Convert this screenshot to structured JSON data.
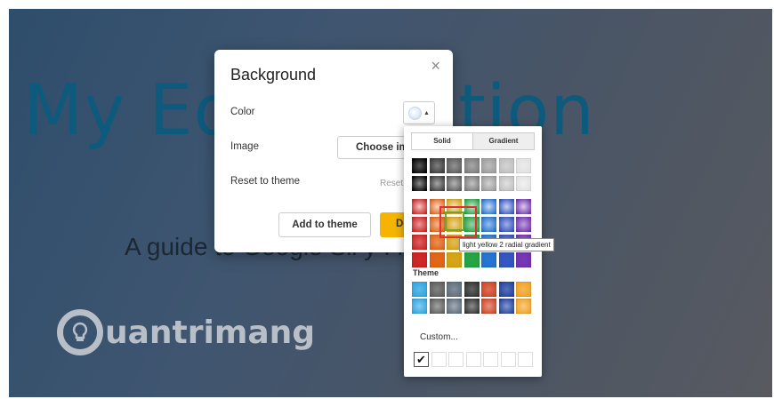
{
  "slide": {
    "title": "My Ed            sentation",
    "subtitle": "A guide to Google Sli          y I love it",
    "watermark": "uantrimang"
  },
  "dialog": {
    "title": "Background",
    "close": "×",
    "color_label": "Color",
    "image_label": "Image",
    "reset_label": "Reset to theme",
    "choose_button": "Choose image",
    "reset_button": "Reset",
    "add_button": "Add to theme",
    "done_button": "Done"
  },
  "picker": {
    "tabs": [
      "Solid",
      "Gradient"
    ],
    "active_tab": "Gradient",
    "grayscale": [
      "#000000",
      "#3a3a3a",
      "#5a5a5a",
      "#7a7a7a",
      "#9a9a9a",
      "#bdbdbd",
      "#e0e0e0"
    ],
    "colors": [
      "#cc2020",
      "#e06010",
      "#d4a010",
      "#20a040",
      "#2070d0",
      "#3050c0",
      "#7030b0"
    ],
    "theme_label": "Theme",
    "theme_colors": [
      "#2aa3e0",
      "#5a5a5a",
      "#5a6a78",
      "#303030",
      "#d04020",
      "#2040a0",
      "#f0a020"
    ],
    "custom_label": "Custom...",
    "custom_check": "✔",
    "tooltip": "light yellow 2 radial gradient",
    "selected": "light yellow 2 radial gradient"
  }
}
